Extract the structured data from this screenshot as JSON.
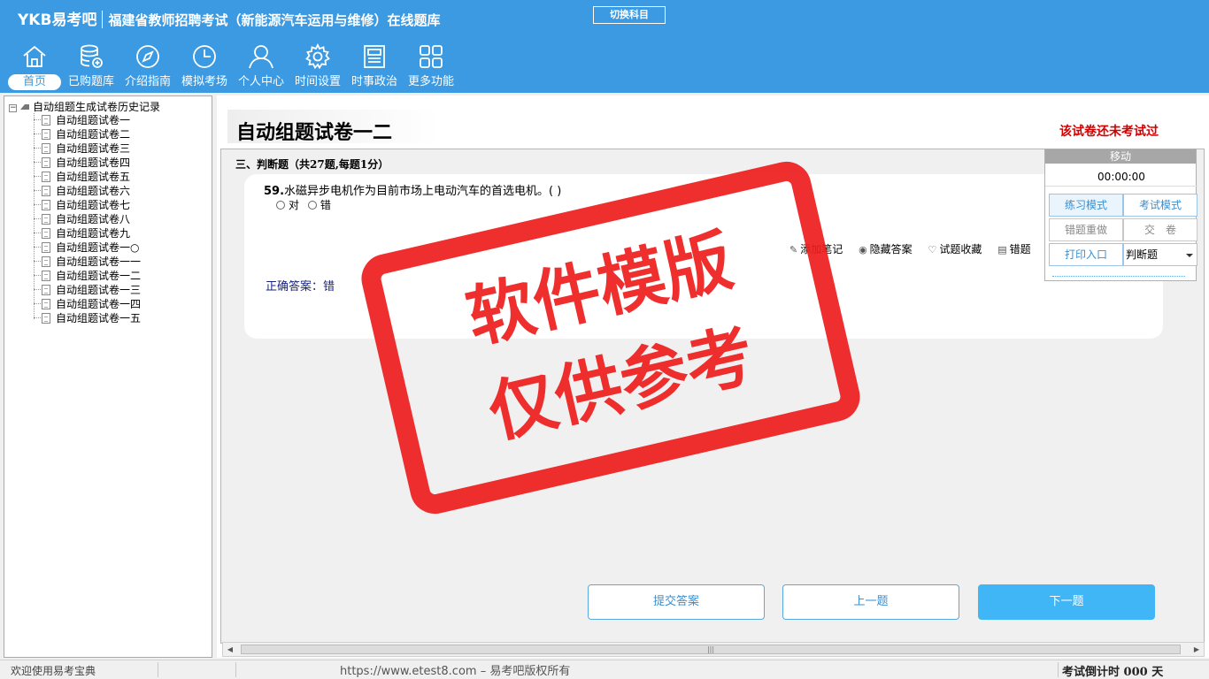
{
  "header": {
    "brand": "YKB易考吧",
    "title": "福建省教师招聘考试（新能源汽车运用与维修）在线题库",
    "switch_label": "切换科目"
  },
  "nav": [
    {
      "label": "首页",
      "icon": "home-icon"
    },
    {
      "label": "已购题库",
      "icon": "database-icon"
    },
    {
      "label": "介绍指南",
      "icon": "compass-icon"
    },
    {
      "label": "模拟考场",
      "icon": "clock-icon"
    },
    {
      "label": "个人中心",
      "icon": "user-icon"
    },
    {
      "label": "时间设置",
      "icon": "gear-icon"
    },
    {
      "label": "时事政治",
      "icon": "news-icon"
    },
    {
      "label": "更多功能",
      "icon": "grid-icon"
    }
  ],
  "tree": {
    "root": "自动组题生成试卷历史记录",
    "items": [
      "自动组题试卷一",
      "自动组题试卷二",
      "自动组题试卷三",
      "自动组题试卷四",
      "自动组题试卷五",
      "自动组题试卷六",
      "自动组题试卷七",
      "自动组题试卷八",
      "自动组题试卷九",
      "自动组题试卷一○",
      "自动组题试卷一一",
      "自动组题试卷一二",
      "自动组题试卷一三",
      "自动组题试卷一四",
      "自动组题试卷一五"
    ]
  },
  "paper": {
    "title": "自动组题试卷一二",
    "status": "该试卷还未考试过",
    "section": "三、判断题（共27题,每题1分）"
  },
  "question": {
    "number": "59.",
    "text": "水磁异步电机作为目前市场上电动汽车的首选电机。(  )",
    "options": [
      "对",
      "错"
    ],
    "answer": "正确答案：错"
  },
  "tools": [
    {
      "label": "添加笔记",
      "icon": "pencil-icon"
    },
    {
      "label": "隐藏答案",
      "icon": "eye-icon"
    },
    {
      "label": "试题收藏",
      "icon": "heart-icon"
    },
    {
      "label": "错题",
      "icon": "book-icon"
    }
  ],
  "buttons": {
    "submit": "提交答案",
    "prev": "上一题",
    "next": "下一题"
  },
  "float_panel": {
    "head": "移动",
    "timer": "00:00:00",
    "practice": "练习模式",
    "exam": "考试模式",
    "redo": "错题重做",
    "hand_in": "交　卷",
    "print": "打印入口",
    "type": "判断题"
  },
  "stamp": {
    "line1": "软件模版",
    "line2": "仅供参考"
  },
  "statusbar": {
    "welcome": "欢迎使用易考宝典",
    "copyright": "https://www.etest8.com – 易考吧版权所有",
    "countdown": "考试倒计时 000 天"
  },
  "colors": {
    "header": "#3b9ae1",
    "stamp": "#ee1d1d",
    "status": "#d40000",
    "primary_button": "#40b6f6"
  }
}
